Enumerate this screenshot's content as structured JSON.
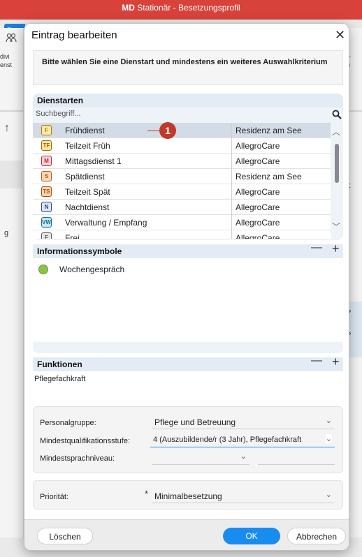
{
  "app": {
    "title_brand": "MD",
    "title_rest": " Stationär - Besetzungsprofil",
    "tab_partial": "P",
    "left_text1": "divi",
    "left_text2": "enst",
    "left_g": "g",
    "right_text1": "er-",
    "right_text2": "un",
    "right_num": "4:",
    "right_p1": "P",
    "right_p2": "P"
  },
  "dialog": {
    "title": "Eintrag bearbeiten",
    "close": "✕",
    "hint": "Bitte wählen Sie eine Dienstart und mindestens ein weiteres Auswahlkriterium"
  },
  "dienstarten": {
    "header": "Dienstarten",
    "search_placeholder": "Suchbegriff...",
    "rows": [
      {
        "code": "F",
        "name": "Frühdienst",
        "org": "Residenz am See",
        "bg": "#fde9a8",
        "fg": "#b07a00",
        "selected": true
      },
      {
        "code": "TF",
        "name": "Teilzeit Früh",
        "org": "AllegroCare",
        "bg": "#fde3a0",
        "fg": "#a06a00",
        "selected": false
      },
      {
        "code": "M",
        "name": "Mittagsdienst 1",
        "org": "AllegroCare",
        "bg": "#f9d0d4",
        "fg": "#b23040",
        "selected": false
      },
      {
        "code": "S",
        "name": "Spätdienst",
        "org": "Residenz am See",
        "bg": "#fbd7b8",
        "fg": "#b35a10",
        "selected": false
      },
      {
        "code": "TS",
        "name": "Teilzeit Spät",
        "org": "AllegroCare",
        "bg": "#fbd0b0",
        "fg": "#a8500a",
        "selected": false
      },
      {
        "code": "N",
        "name": "Nachtdienst",
        "org": "AllegroCare",
        "bg": "#dce4f2",
        "fg": "#2a4a80",
        "selected": false
      },
      {
        "code": "VW",
        "name": "Verwaltung / Empfang",
        "org": "AllegroCare",
        "bg": "#bfe6f2",
        "fg": "#1a7090",
        "selected": false
      },
      {
        "code": "F",
        "name": "Frei",
        "org": "AllegroCare",
        "bg": "#e6e6e6",
        "fg": "#555",
        "selected": false
      }
    ],
    "marker": "1"
  },
  "informationssymbole": {
    "header": "Informationssymbole",
    "minus": "—",
    "plus": "+",
    "item": "Wochengespräch"
  },
  "funktionen": {
    "header": "Funktionen",
    "minus": "—",
    "plus": "+",
    "item": "Pflegefachkraft"
  },
  "form": {
    "personalgruppe_label": "Personalgruppe:",
    "personalgruppe_value": "Pflege und Betreuung",
    "mindestqual_label": "Mindestqualifikationsstufe:",
    "mindestqual_value": "4 (Auszubildende/r (3 Jahr), Pflegefachkraft",
    "mindestsprach_label": "Mindestsprachniveau:",
    "mindestsprach_value": "",
    "prioritaet_label": "Priorität:",
    "prioritaet_value": "Minimalbesetzung",
    "required_mark": "*",
    "chevron": "⌄"
  },
  "footer": {
    "delete_label": "Löschen",
    "ok_label": "OK",
    "cancel_label": "Abbrechen"
  },
  "colors": {
    "titlebar": "#d8423b",
    "accent": "#1a8cf0",
    "selected_row": "#d2dbe6",
    "marker": "#c0392b"
  }
}
